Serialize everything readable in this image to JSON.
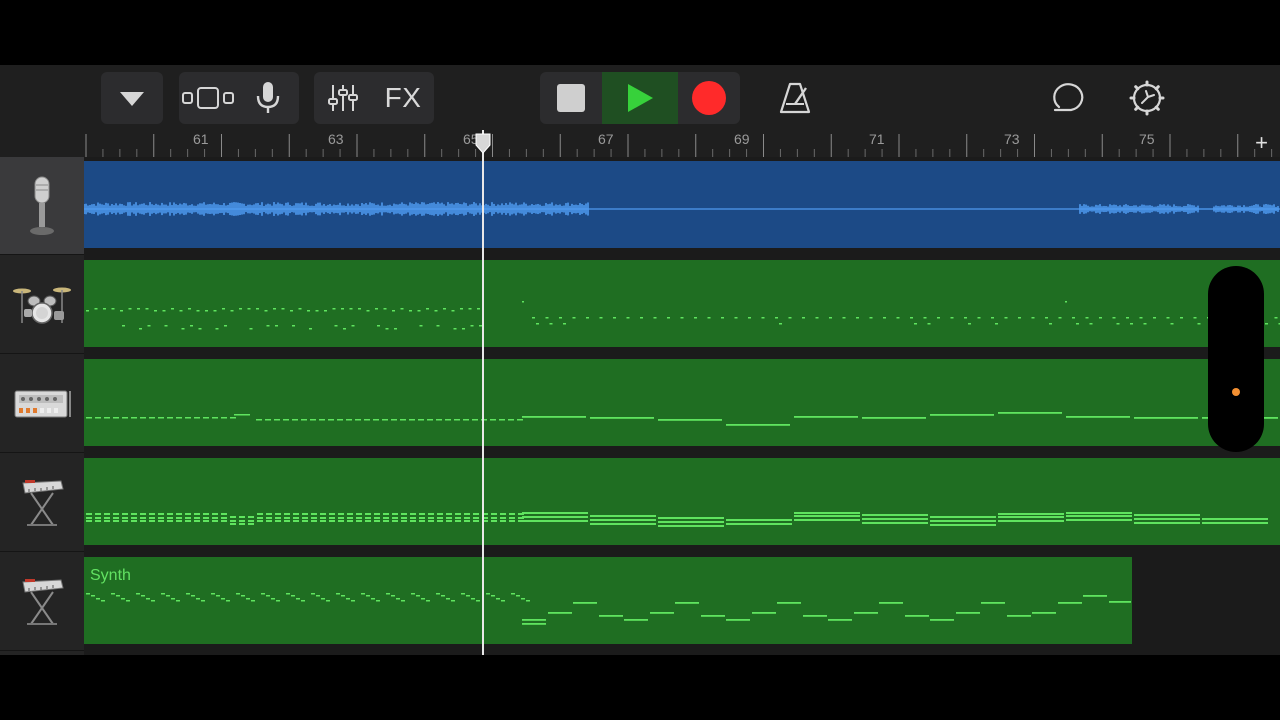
{
  "toolbar": {
    "browser": "triangle-down-icon",
    "view": "tracks-view-icon",
    "mic": "microphone-icon",
    "mixer": "mixer-sliders-icon",
    "fx_label": "FX",
    "stop": "stop-icon",
    "play": "play-icon",
    "record": "record-icon",
    "metronome": "metronome-icon",
    "loop": "loop-browser-icon",
    "settings": "settings-gear-icon"
  },
  "ruler": {
    "bar_labels": [
      "61",
      "63",
      "65",
      "67",
      "69",
      "71",
      "73",
      "75"
    ],
    "add_label": "+"
  },
  "tracks": [
    {
      "instrument": "microphone-icon",
      "type": "audio",
      "selected": true
    },
    {
      "instrument": "drum-kit-icon",
      "type": "midi"
    },
    {
      "instrument": "drum-machine-icon",
      "type": "midi"
    },
    {
      "instrument": "keyboard-icon",
      "type": "midi"
    },
    {
      "instrument": "keyboard-icon",
      "type": "midi",
      "region_label": "Synth"
    }
  ],
  "colors": {
    "audio_region": "#1c4a86",
    "audio_wave": "#4f9bf0",
    "midi_region": "#1f6e22",
    "midi_note": "#5fe45f",
    "play": "#37d13b",
    "record": "#ff2a2a",
    "accent_dot": "#f39032"
  }
}
